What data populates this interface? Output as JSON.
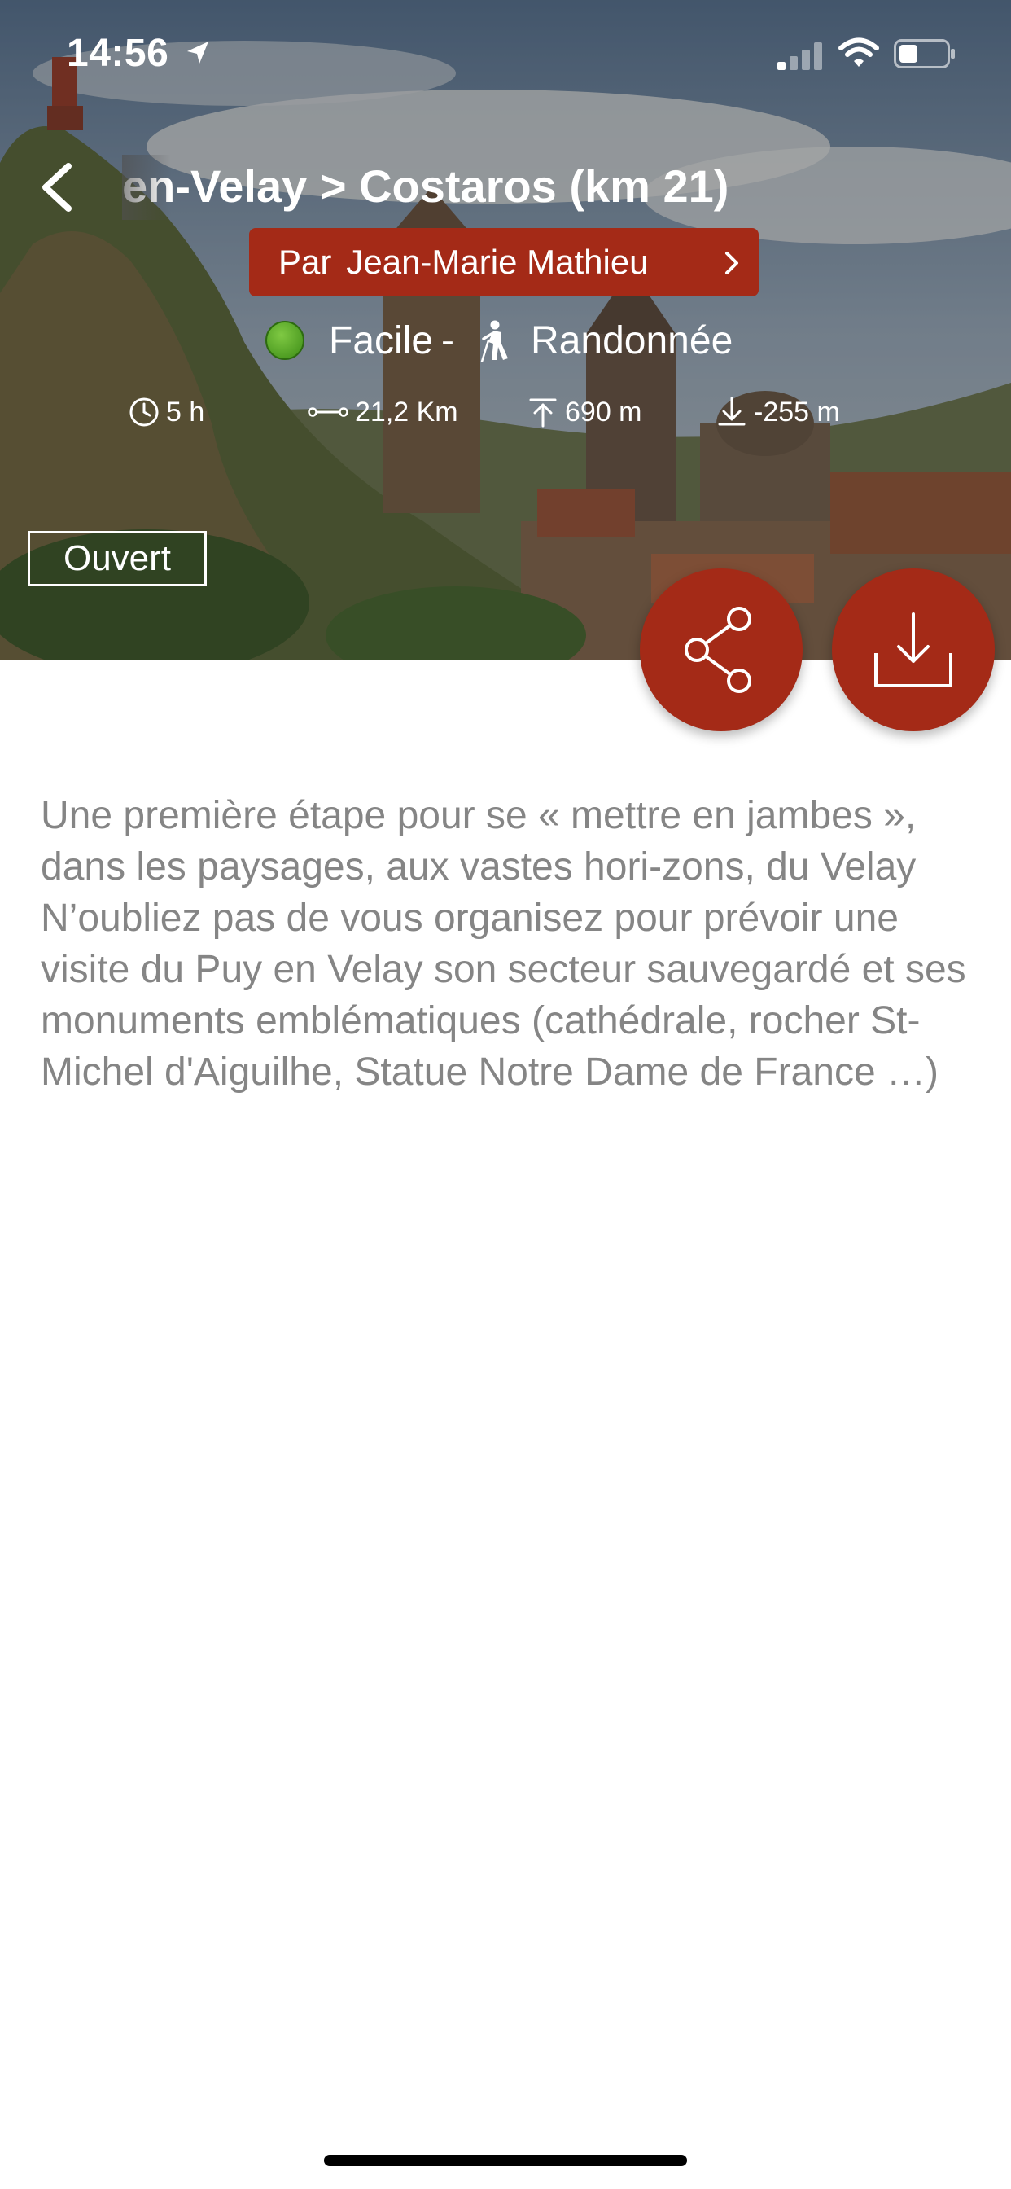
{
  "status_bar": {
    "time": "14:56"
  },
  "header": {
    "title": "en-Velay > Costaros (km 21)",
    "author_prefix": "Par",
    "author_name": "Jean-Marie Mathieu"
  },
  "trail": {
    "difficulty": "Facile",
    "separator": "-",
    "activity": "Randonnée",
    "difficulty_color": "#4a9b1f",
    "stats": {
      "duration": "5 h",
      "distance": "21,2 Km",
      "ascent": "690 m",
      "descent": "-255 m"
    },
    "status": "Ouvert"
  },
  "colors": {
    "accent": "#a42a17",
    "description_text": "#858585"
  },
  "icons": {
    "back": "chevron-left-icon",
    "share": "share-icon",
    "download": "download-icon"
  },
  "description": {
    "paragraph1": "Une première étape pour se « mettre en jambes », dans les paysages, aux vastes hori-zons, du Velay",
    "paragraph2": "N’oubliez pas de vous organisez pour prévoir une visite du Puy en Velay son secteur sauvegardé et ses monuments emblématiques (cathédrale, rocher St-Michel d'Aiguilhe, Statue Notre Dame de France …)"
  }
}
